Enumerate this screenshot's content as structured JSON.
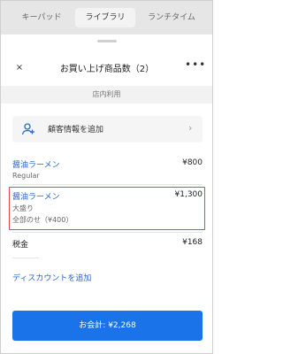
{
  "tabs": [
    "キーパッド",
    "ライブラリ",
    "ランチタイム"
  ],
  "header": {
    "close_glyph": "×",
    "title": "お買い上げ商品数（2）",
    "more_glyph": "•••"
  },
  "order_type": "店内利用",
  "customer": {
    "label": "顧客情報を追加",
    "icon": "add-person-icon",
    "chevron": "›"
  },
  "items": [
    {
      "name": "醤油ラーメン",
      "price": "¥800",
      "details": [
        "Regular"
      ]
    },
    {
      "name": "醤油ラーメン",
      "price": "¥1,300",
      "details": [
        "大盛り",
        "全部のせ（¥400）"
      ]
    }
  ],
  "tax": {
    "label": "税金",
    "value": "¥168"
  },
  "discount_label": "ディスカウントを追加",
  "checkout_label": "お会計: ¥2,268",
  "colors": {
    "accent": "#1a73e8",
    "link": "#2b67c7",
    "highlight": "#e0474c"
  }
}
